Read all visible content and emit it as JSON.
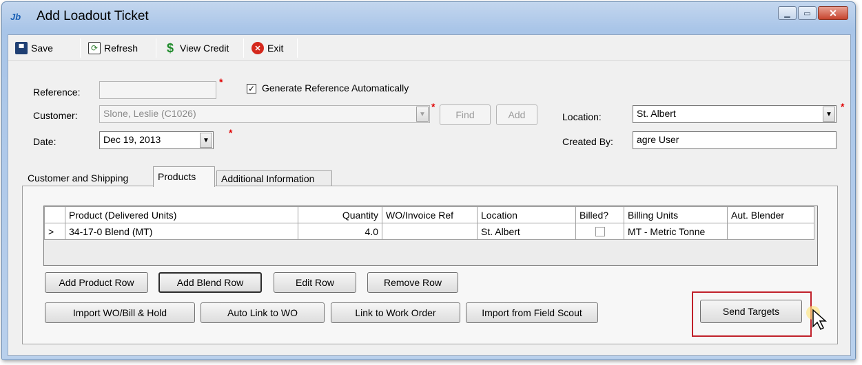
{
  "window": {
    "title": "Add Loadout Ticket",
    "app_icon": "Jb"
  },
  "toolbar": {
    "save": "Save",
    "refresh": "Refresh",
    "view_credit": "View Credit",
    "exit": "Exit"
  },
  "form": {
    "reference_label": "Reference:",
    "reference_value": "",
    "generate_ref_label": "Generate Reference Automatically",
    "generate_ref_checked": true,
    "customer_label": "Customer:",
    "customer_value": "Slone, Leslie (C1026)",
    "find_button": "Find",
    "add_button": "Add",
    "date_label": "Date:",
    "date_value": "Dec 19, 2013",
    "location_label": "Location:",
    "location_value": "St. Albert",
    "created_by_label": "Created By:",
    "created_by_value": "agre User"
  },
  "tabs": [
    {
      "label": "Customer and Shipping",
      "active": false
    },
    {
      "label": "Products",
      "active": true
    },
    {
      "label": "Additional Information",
      "active": false
    }
  ],
  "grid": {
    "columns": [
      "Product (Delivered Units)",
      "Quantity",
      "WO/Invoice Ref",
      "Location",
      "Billed?",
      "Billing Units",
      "Aut. Blender"
    ],
    "rows": [
      {
        "marker": ">",
        "product": "34-17-0 Blend (MT)",
        "quantity": "4.0",
        "wo_ref": "",
        "location": "St. Albert",
        "billed": false,
        "billing_units": "MT - Metric Tonne",
        "aut_blender": ""
      }
    ]
  },
  "buttons": {
    "add_product_row": "Add Product Row",
    "add_blend_row": "Add Blend Row",
    "edit_row": "Edit Row",
    "remove_row": "Remove Row",
    "import_wo": "Import WO/Bill & Hold",
    "auto_link": "Auto Link to WO",
    "link_wo": "Link to Work Order",
    "import_field_scout": "Import from Field Scout",
    "send_targets": "Send Targets"
  },
  "colors": {
    "highlight": "#c0202a",
    "required": "#e00000"
  }
}
